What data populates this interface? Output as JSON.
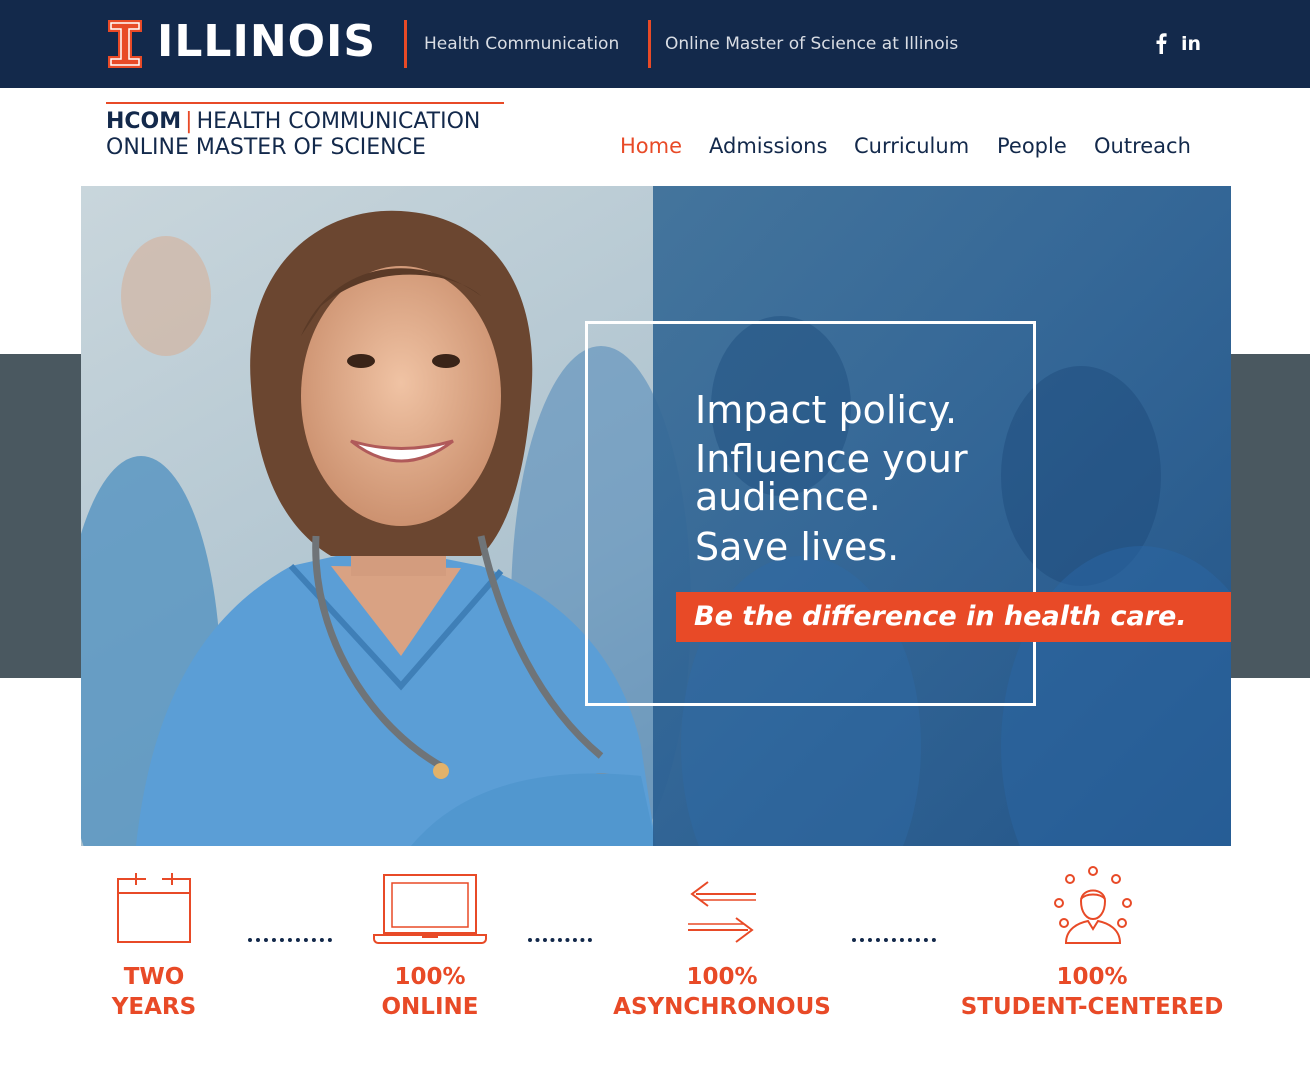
{
  "topbar": {
    "brand": "ILLINOIS",
    "links": [
      "Health Communication",
      "Online Master of Science at Illinois"
    ],
    "social": [
      {
        "icon": "facebook-icon",
        "label": "f"
      },
      {
        "icon": "linkedin-icon",
        "label": "in"
      }
    ]
  },
  "logo": {
    "abbr": "HCOM",
    "separator": "|",
    "line1": "HEALTH COMMUNICATION",
    "line2": "ONLINE MASTER OF SCIENCE"
  },
  "nav": {
    "items": [
      "Home",
      "Admissions",
      "Curriculum",
      "People",
      "Outreach"
    ],
    "active": "Home"
  },
  "hero": {
    "line1": "Impact policy.",
    "line2": "Influence your audience.",
    "line3": "Save lives.",
    "cta": "Be the difference in health care."
  },
  "features": [
    {
      "icon": "calendar-icon",
      "line1": "TWO",
      "line2": "YEARS"
    },
    {
      "icon": "laptop-icon",
      "line1": "100%",
      "line2": "ONLINE"
    },
    {
      "icon": "arrows-exchange-icon",
      "line1": "100%",
      "line2": "ASYNCHRONOUS"
    },
    {
      "icon": "student-icon",
      "line1": "100%",
      "line2": "STUDENT-CENTERED"
    }
  ],
  "colors": {
    "navy": "#13294b",
    "orange": "#e84a27",
    "slate": "#4a5860"
  }
}
